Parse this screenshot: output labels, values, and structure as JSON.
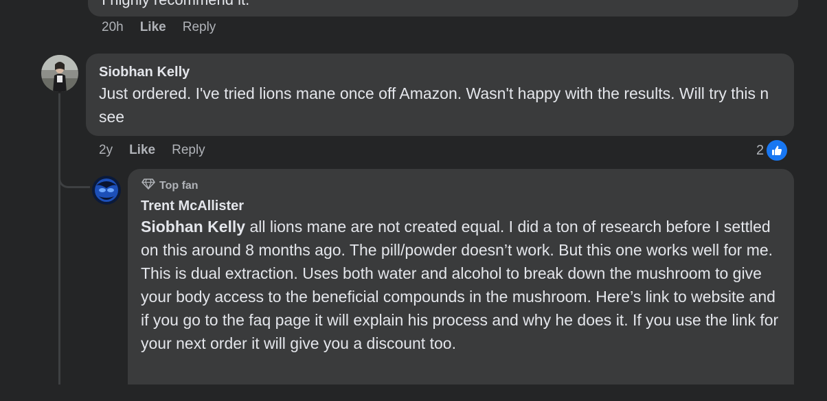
{
  "previous_comment": {
    "text_fragment": "I highly recommend it.",
    "time": "20h",
    "like_label": "Like",
    "reply_label": "Reply"
  },
  "comment": {
    "author": "Siobhan Kelly",
    "text": "Just ordered. I've tried lions mane once off Amazon. Wasn't happy with the results. Will try this n see",
    "time": "2y",
    "like_label": "Like",
    "reply_label": "Reply",
    "reaction_count": "2",
    "reaction_icon": "thumbs-up-icon",
    "reaction_color": "#1877f2"
  },
  "reply": {
    "badge_label": "Top fan",
    "badge_icon": "diamond-icon",
    "author": "Trent McAllister",
    "mention": "Siobhan Kelly",
    "text": " all lions mane are not created equal. I did a ton of research before I settled on this around 8 months ago. The pill/powder doesn’t work. But this one works well for me. This is dual extraction. Uses both water and alcohol to break down the mushroom to give your body access to the beneficial compounds in the mushroom. Here’s link to website and if you go to the faq page it will explain his process and why he does it. If you use the link for your next order it will give you a discount too."
  }
}
